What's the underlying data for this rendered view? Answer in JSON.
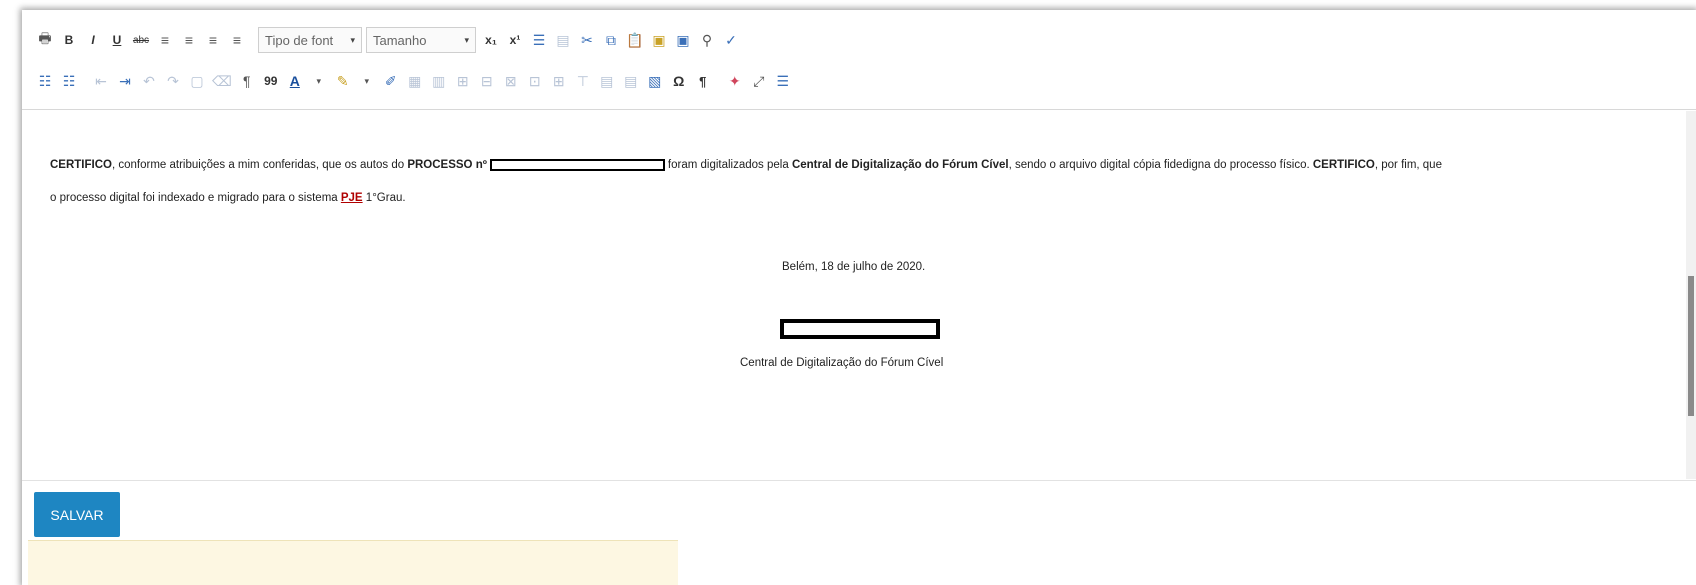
{
  "toolbar": {
    "font_family_placeholder": "Tipo de font",
    "font_size_placeholder": "Tamanho",
    "bold": "B",
    "italic": "I",
    "underline": "U",
    "strike": "abc",
    "subscript": "x₁",
    "superscript": "x¹",
    "omega": "Ω",
    "pilcrow": "¶",
    "blockquote": "99",
    "text_color": "A"
  },
  "document": {
    "p1_prefix": "CERTIFICO",
    "p1_part1": ", conforme atribuições a mim conferidas, que os autos do ",
    "p1_processo": "PROCESSO nº",
    "p1_part2": "foram digitalizados pela ",
    "p1_central": "Central de Digitalização do Fórum Cível",
    "p1_part3": ", sendo o arquivo digital cópia fidedigna do processo físico. ",
    "p1_certifico2": "CERTIFICO",
    "p1_part4": ", por fim, que",
    "p2_part1": "o processo digital foi indexado e migrado para o sistema ",
    "p2_pje": "PJE",
    "p2_part2": " 1°Grau.",
    "date_line": "Belém, 18 de julho de 2020.",
    "signature_caption": "Central de Digitalização do Fórum Cível"
  },
  "actions": {
    "save_label": "SALVAR"
  }
}
